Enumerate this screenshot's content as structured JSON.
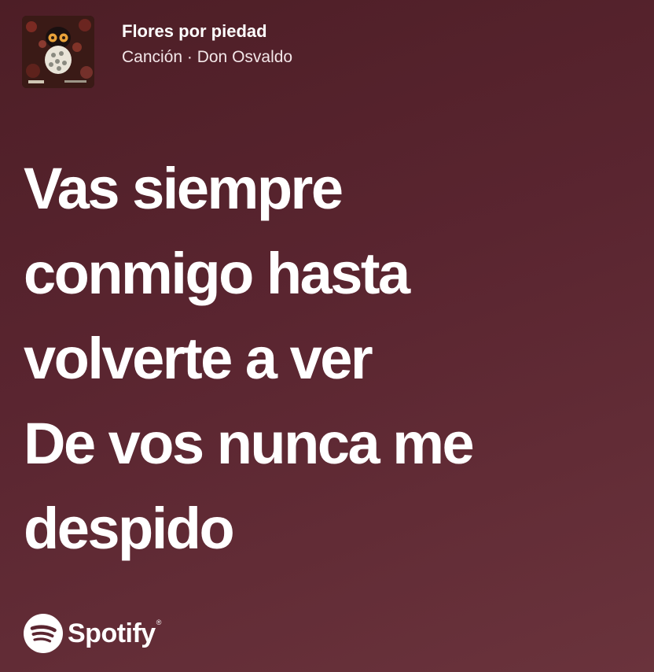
{
  "track": {
    "title": "Flores por piedad",
    "subtitle": "Canción · Don Osvaldo",
    "cover_icon": "album-cover-skull-with-flowers"
  },
  "lyrics": {
    "lines": [
      "Vas siempre",
      "conmigo hasta",
      "volverte a ver",
      "De vos nunca me",
      "despido"
    ]
  },
  "brand": {
    "name": "Spotify",
    "registered_mark": "®",
    "icon": "spotify-logo-icon"
  },
  "colors": {
    "background_start": "#4d1e26",
    "background_end": "#6a333c",
    "text": "#ffffff"
  }
}
